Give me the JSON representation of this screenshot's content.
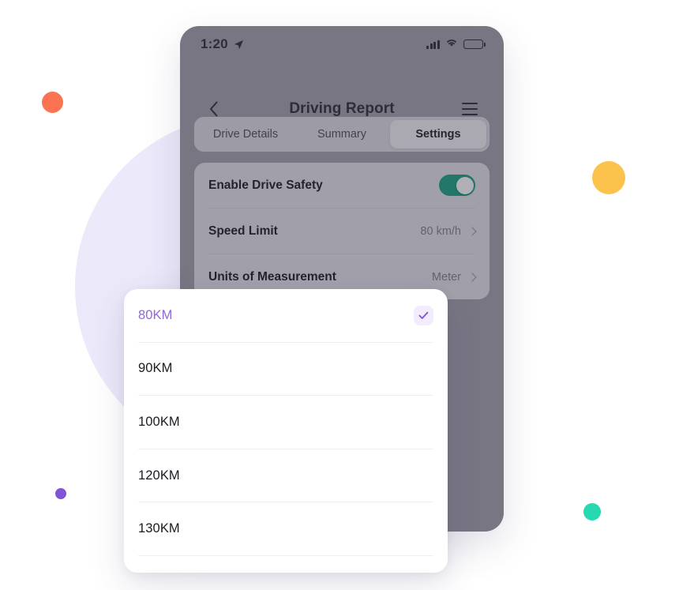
{
  "phone": {
    "status_bar": {
      "time": "1:20",
      "location_icon": "location-arrow-icon",
      "signal_icon": "cellular-signal-icon",
      "wifi_icon": "wifi-icon",
      "battery_icon": "battery-full-icon"
    },
    "nav": {
      "back_icon": "chevron-left-icon",
      "title": "Driving Report",
      "menu_icon": "hamburger-menu-icon"
    },
    "tabs": [
      {
        "label": "Drive Details",
        "active": false
      },
      {
        "label": "Summary",
        "active": false
      },
      {
        "label": "Settings",
        "active": true
      }
    ],
    "settings": [
      {
        "label": "Enable Drive Safety",
        "control": "toggle",
        "value": "on"
      },
      {
        "label": "Speed Limit",
        "control": "disclosure",
        "value": "80 km/h"
      },
      {
        "label": "Units of Measurement",
        "control": "disclosure",
        "value": "Meter"
      }
    ]
  },
  "picker": {
    "options": [
      {
        "label": "80KM",
        "selected": true
      },
      {
        "label": "90KM",
        "selected": false
      },
      {
        "label": "100KM",
        "selected": false
      },
      {
        "label": "120KM",
        "selected": false
      },
      {
        "label": "130KM",
        "selected": false
      }
    ],
    "check_icon": "check-icon"
  },
  "decor": {
    "blob_color": "#ece9fa",
    "orange_color": "#fb7351",
    "yellow_color": "#fbc24c",
    "purple_color": "#8054d4",
    "teal_color": "#27d9b0"
  },
  "colors": {
    "accent_purple": "#9166d9",
    "toggle_on": "#0fa07d",
    "check_badge_bg": "#f3ecfd"
  }
}
